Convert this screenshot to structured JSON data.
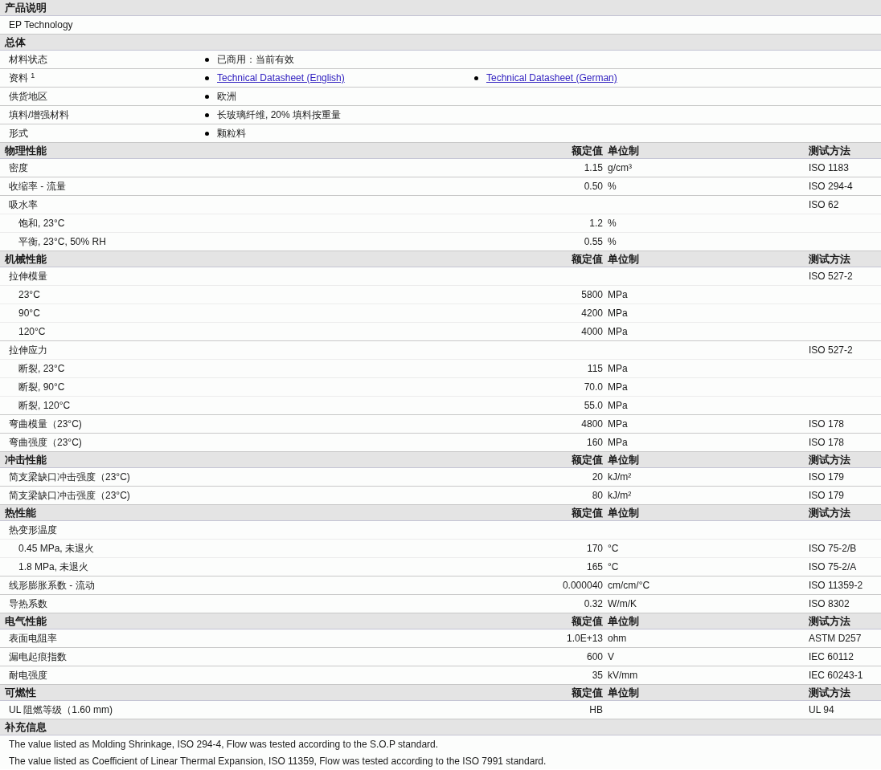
{
  "sections": [
    {
      "kind": "text",
      "title": "产品说明",
      "lines": [
        "EP Technology"
      ]
    },
    {
      "kind": "general",
      "title": "总体",
      "rows": [
        {
          "label": "材料状态",
          "items": [
            {
              "kind": "text",
              "text": "已商用：当前有效"
            }
          ]
        },
        {
          "label": "资料 $^{1}$",
          "items": [
            {
              "kind": "link",
              "text": "Technical Datasheet (English)"
            },
            {
              "kind": "link",
              "text": "Technical Datasheet (German)"
            }
          ]
        },
        {
          "label": "供货地区",
          "items": [
            {
              "kind": "text",
              "text": "欧洲"
            }
          ]
        },
        {
          "label": "填料/增强材料",
          "items": [
            {
              "kind": "text",
              "text": "长玻璃纤维, 20% 填料按重量"
            }
          ]
        },
        {
          "label": "形式",
          "items": [
            {
              "kind": "text",
              "text": "颗粒料"
            }
          ]
        }
      ]
    },
    {
      "kind": "properties",
      "title": "物理性能",
      "headings": {
        "value": "额定值",
        "unit": "单位制",
        "method": "测试方法"
      },
      "rows": [
        {
          "label": "密度",
          "value": "1.15",
          "unit": "g/cm³",
          "method": "ISO 1183",
          "indented": false
        },
        {
          "label": "收缩率  - 流量",
          "value": "0.50",
          "unit": "%",
          "method": "ISO 294-4",
          "indented": false
        },
        {
          "label": "吸水率",
          "method": "ISO 62",
          "indented": false
        },
        {
          "label": "饱和, 23°C",
          "value": "1.2",
          "unit": "%",
          "indented": true
        },
        {
          "label": "平衡, 23°C, 50% RH",
          "value": "0.55",
          "unit": "%",
          "indented": true
        }
      ]
    },
    {
      "kind": "properties",
      "title": "机械性能",
      "headings": {
        "value": "额定值",
        "unit": "单位制",
        "method": "测试方法"
      },
      "rows": [
        {
          "label": "拉伸模量",
          "method": "ISO 527-2",
          "indented": false
        },
        {
          "label": "23°C",
          "value": "5800",
          "unit": "MPa",
          "indented": true
        },
        {
          "label": "90°C",
          "value": "4200",
          "unit": "MPa",
          "indented": true
        },
        {
          "label": "120°C",
          "value": "4000",
          "unit": "MPa",
          "indented": true
        },
        {
          "label": "拉伸应力",
          "method": "ISO 527-2",
          "indented": false
        },
        {
          "label": "断裂, 23°C",
          "value": "115",
          "unit": "MPa",
          "indented": true
        },
        {
          "label": "断裂, 90°C",
          "value": "70.0",
          "unit": "MPa",
          "indented": true
        },
        {
          "label": "断裂, 120°C",
          "value": "55.0",
          "unit": "MPa",
          "indented": true
        },
        {
          "label": "弯曲模量（23°C)",
          "value": "4800",
          "unit": "MPa",
          "method": "ISO 178",
          "indented": false
        },
        {
          "label": "弯曲强度（23°C)",
          "value": "160",
          "unit": "MPa",
          "method": "ISO 178",
          "indented": false
        }
      ]
    },
    {
      "kind": "properties",
      "title": "冲击性能",
      "headings": {
        "value": "额定值",
        "unit": "单位制",
        "method": "测试方法"
      },
      "rows": [
        {
          "label": "简支梁缺口冲击强度（23°C)",
          "value": "20",
          "unit": "kJ/m²",
          "method": "ISO 179",
          "indented": false
        },
        {
          "label": "简支梁缺口冲击强度（23°C)",
          "value": "80",
          "unit": "kJ/m²",
          "method": "ISO 179",
          "indented": false
        }
      ]
    },
    {
      "kind": "properties",
      "title": "热性能",
      "headings": {
        "value": "额定值",
        "unit": "单位制",
        "method": "测试方法"
      },
      "rows": [
        {
          "label": "热变形温度",
          "indented": false
        },
        {
          "label": "0.45 MPa, 未退火",
          "value": "170",
          "unit": "°C",
          "method": "ISO 75-2/B",
          "indented": true
        },
        {
          "label": "1.8 MPa, 未退火",
          "value": "165",
          "unit": "°C",
          "method": "ISO 75-2/A",
          "indented": true
        },
        {
          "label": "线形膨胀系数  - 流动",
          "value": "0.000040",
          "unit": "cm/cm/°C",
          "method": "ISO 11359-2",
          "indented": false
        },
        {
          "label": "导热系数",
          "value": "0.32",
          "unit": "W/m/K",
          "method": "ISO 8302",
          "indented": false
        }
      ]
    },
    {
      "kind": "properties",
      "title": "电气性能",
      "headings": {
        "value": "额定值",
        "unit": "单位制",
        "method": "测试方法"
      },
      "rows": [
        {
          "label": "表面电阻率",
          "value": "1.0E+13",
          "unit": "ohm",
          "method": "ASTM D257",
          "indented": false
        },
        {
          "label": "漏电起痕指数",
          "value": "600",
          "unit": "V",
          "method": "IEC 60112",
          "indented": false
        },
        {
          "label": "耐电强度",
          "value": "35",
          "unit": "kV/mm",
          "method": "IEC 60243-1",
          "indented": false
        }
      ]
    },
    {
      "kind": "properties",
      "title": "可燃性",
      "headings": {
        "value": "额定值",
        "unit": "单位制",
        "method": "测试方法"
      },
      "rows": [
        {
          "label": "UL 阻燃等级（1.60 mm)",
          "value": "HB",
          "method": "UL 94",
          "indented": false
        }
      ]
    },
    {
      "kind": "notes",
      "title": "补充信息",
      "lines": [
        "The value listed as Molding Shrinkage, ISO 294-4, Flow was tested according to the S.O.P standard.",
        "The value listed as Coefficient of Linear Thermal Expansion, ISO 11359, Flow was tested according to the ISO 7991 standard."
      ]
    }
  ]
}
